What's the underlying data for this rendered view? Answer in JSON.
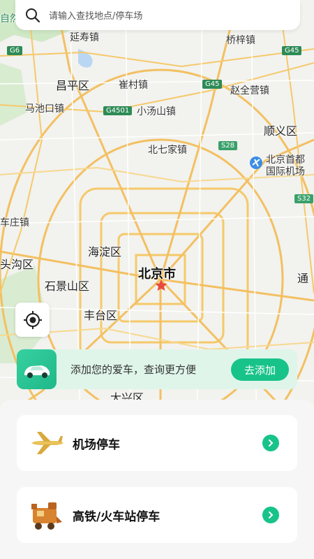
{
  "search": {
    "placeholder": "请输入查找地点/停车场"
  },
  "map": {
    "labels": {
      "yanshou": "延寿镇",
      "qiaozi": "桥梓镇",
      "changping": "昌平区",
      "cuicun": "崔村镇",
      "zhaoquanying": "赵全营镇",
      "machikou": "马池口镇",
      "xiaotangshan": "小汤山镇",
      "shunyi": "顺义区",
      "beiqijia": "北七家镇",
      "airport_line1": "北京首都",
      "airport_line2": "国际机场",
      "chezhuang": "车庄镇",
      "haidian": "海淀区",
      "beijing": "北京市",
      "mentougou": "头沟区",
      "shijingshan": "石景山区",
      "tong": "通",
      "fengtai": "丰台区",
      "daxing": "大兴区",
      "ziran": "自然"
    },
    "shields": {
      "g6": "G6",
      "g45a": "G45",
      "g45b": "G45",
      "g4501": "G4501",
      "s28": "S28",
      "s32": "S32"
    }
  },
  "banner": {
    "text": "添加您的爱车，查询更方便",
    "button": "去添加"
  },
  "cards": [
    {
      "label": "机场停车",
      "icon": "airplane-icon"
    },
    {
      "label": "高铁/火车站停车",
      "icon": "train-icon"
    }
  ],
  "colors": {
    "accent": "#18c38a",
    "banner_bg": "#dff5ea",
    "road": "#f5c96a"
  }
}
